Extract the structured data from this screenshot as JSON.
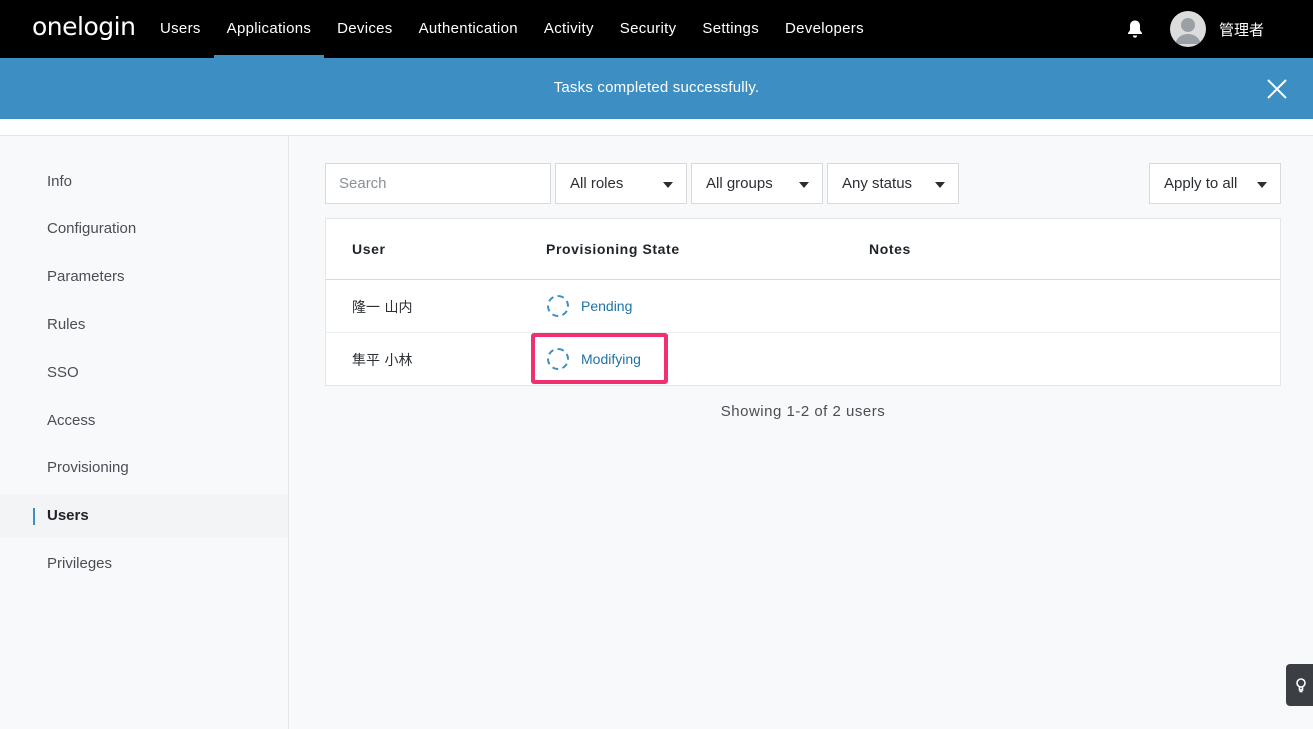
{
  "brand": {
    "logo_text": "onelogin"
  },
  "nav": {
    "items": [
      {
        "label": "Users"
      },
      {
        "label": "Applications",
        "active": true
      },
      {
        "label": "Devices"
      },
      {
        "label": "Authentication"
      },
      {
        "label": "Activity"
      },
      {
        "label": "Security"
      },
      {
        "label": "Settings"
      },
      {
        "label": "Developers"
      }
    ],
    "username": "管理者"
  },
  "banner": {
    "message": "Tasks completed successfully."
  },
  "sidebar": {
    "items": [
      {
        "label": "Info"
      },
      {
        "label": "Configuration"
      },
      {
        "label": "Parameters"
      },
      {
        "label": "Rules"
      },
      {
        "label": "SSO"
      },
      {
        "label": "Access"
      },
      {
        "label": "Provisioning"
      },
      {
        "label": "Users",
        "active": true
      },
      {
        "label": "Privileges"
      }
    ]
  },
  "filters": {
    "search_placeholder": "Search",
    "roles": "All roles",
    "groups": "All groups",
    "status": "Any status",
    "apply": "Apply to all"
  },
  "table": {
    "columns": [
      "User",
      "Provisioning State",
      "Notes"
    ],
    "rows": [
      {
        "user": "隆一 山内",
        "state": "Pending",
        "notes": ""
      },
      {
        "user": "隼平 小林",
        "state": "Modifying",
        "notes": ""
      }
    ]
  },
  "footer": {
    "showing": "Showing 1-2 of 2 users"
  },
  "colors": {
    "accent": "#3d8fc3",
    "highlight": "#f0306f",
    "link": "#1e73a6"
  },
  "icons": {
    "notifications": "bell-icon",
    "close": "close-icon",
    "status": "spinner-icon",
    "help": "lightbulb-icon"
  }
}
